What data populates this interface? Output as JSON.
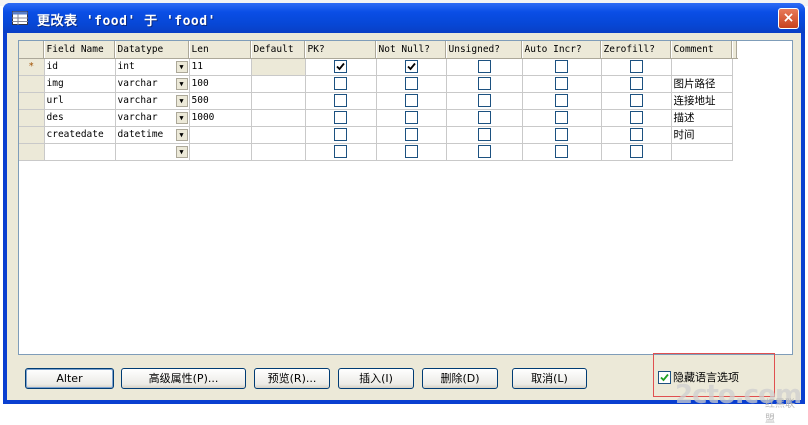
{
  "window": {
    "title": "更改表 'food' 于 'food'",
    "close_glyph": "×",
    "title_bar_color": "#0747d6"
  },
  "grid": {
    "columns": [
      "Field Name",
      "Datatype",
      "Len",
      "Default",
      "PK?",
      "Not Null?",
      "Unsigned?",
      "Auto Incr?",
      "Zerofill?",
      "Comment"
    ],
    "highlighted_column": "Default",
    "current_row_marker": "*",
    "rows": [
      {
        "field": "id",
        "type": "int",
        "len": "11",
        "default": "",
        "pk": true,
        "notnull": true,
        "unsigned": false,
        "autoinc": false,
        "zerofill": false,
        "comment": ""
      },
      {
        "field": "img",
        "type": "varchar",
        "len": "100",
        "default": "",
        "pk": false,
        "notnull": false,
        "unsigned": false,
        "autoinc": false,
        "zerofill": false,
        "comment": "图片路径"
      },
      {
        "field": "url",
        "type": "varchar",
        "len": "500",
        "default": "",
        "pk": false,
        "notnull": false,
        "unsigned": false,
        "autoinc": false,
        "zerofill": false,
        "comment": "连接地址"
      },
      {
        "field": "des",
        "type": "varchar",
        "len": "1000",
        "default": "",
        "pk": false,
        "notnull": false,
        "unsigned": false,
        "autoinc": false,
        "zerofill": false,
        "comment": "描述"
      },
      {
        "field": "createdate",
        "type": "datetime",
        "len": "",
        "default": "",
        "pk": false,
        "notnull": false,
        "unsigned": false,
        "autoinc": false,
        "zerofill": false,
        "comment": "时间"
      },
      {
        "field": "",
        "type": "",
        "len": "",
        "default": "",
        "pk": false,
        "notnull": false,
        "unsigned": false,
        "autoinc": false,
        "zerofill": false,
        "comment": ""
      }
    ]
  },
  "buttons": {
    "alter": "Alter",
    "advanced": "高级属性(P)...",
    "preview": "预览(R)...",
    "insert": "插入(I)",
    "delete": "删除(D)",
    "cancel": "取消(L)"
  },
  "hide_language_option": {
    "label": "隐藏语言选项",
    "checked": true
  },
  "watermark": {
    "text": "2cto.com",
    "subtext": "红黑联盟"
  },
  "icons": {
    "title_icon": "table-edit-icon",
    "close": "close-icon",
    "dropdown": "chevron-down-icon",
    "check": "checkmark-icon"
  }
}
